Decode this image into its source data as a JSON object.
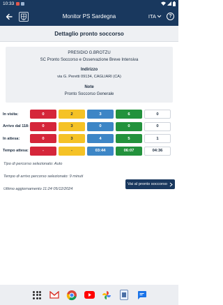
{
  "status_bar": {
    "time": "10:33"
  },
  "app_bar": {
    "title": "Monitor PS Sardegna",
    "language": "ITA",
    "help_label": "?"
  },
  "page_title": "Dettaglio pronto soccorso",
  "info_card": {
    "presidio": "PRESIDIO G.BROTZU",
    "unit": "SC  Pronto Soccorso e Osservazione Breve Intensiva",
    "address_heading": "Indirizzo",
    "address": "via G. Peretti 09134, CAGLIARI (CA)",
    "notes_heading": "Note",
    "notes": "Pronto Soccorso Generale"
  },
  "color_codes": {
    "red": "#d5263a",
    "yellow": "#f5c226",
    "blue": "#3d86c6",
    "green": "#23923c",
    "white": "#ffffff"
  },
  "table": {
    "rows": [
      {
        "label": "In visita:",
        "values": [
          "0",
          "2",
          "3",
          "6",
          "0"
        ]
      },
      {
        "label": "Arrivo dal 118:",
        "values": [
          "0",
          "3",
          "0",
          "0",
          "0"
        ]
      },
      {
        "label": "In attesa:",
        "values": [
          "0",
          "3",
          "4",
          "5",
          "1"
        ]
      },
      {
        "label": "Tempo attesa:",
        "values": [
          "-",
          "-",
          "03:44",
          "06:07",
          "04:36"
        ]
      }
    ]
  },
  "details": {
    "route_type": "Tipo di percorso selezionato: Auto",
    "arrival_time": "Tempo di arrivo percorso selezionato: 9 minuti",
    "last_update": "Ultimo aggiornamento 11:24  05/12/2024"
  },
  "go_button": {
    "label": "Vai al pronto soccorso"
  },
  "dock": {
    "apps": [
      "apps-grid-icon",
      "gmail-icon",
      "chrome-icon",
      "youtube-icon",
      "photos-icon",
      "files-icon",
      "messages-icon"
    ]
  }
}
